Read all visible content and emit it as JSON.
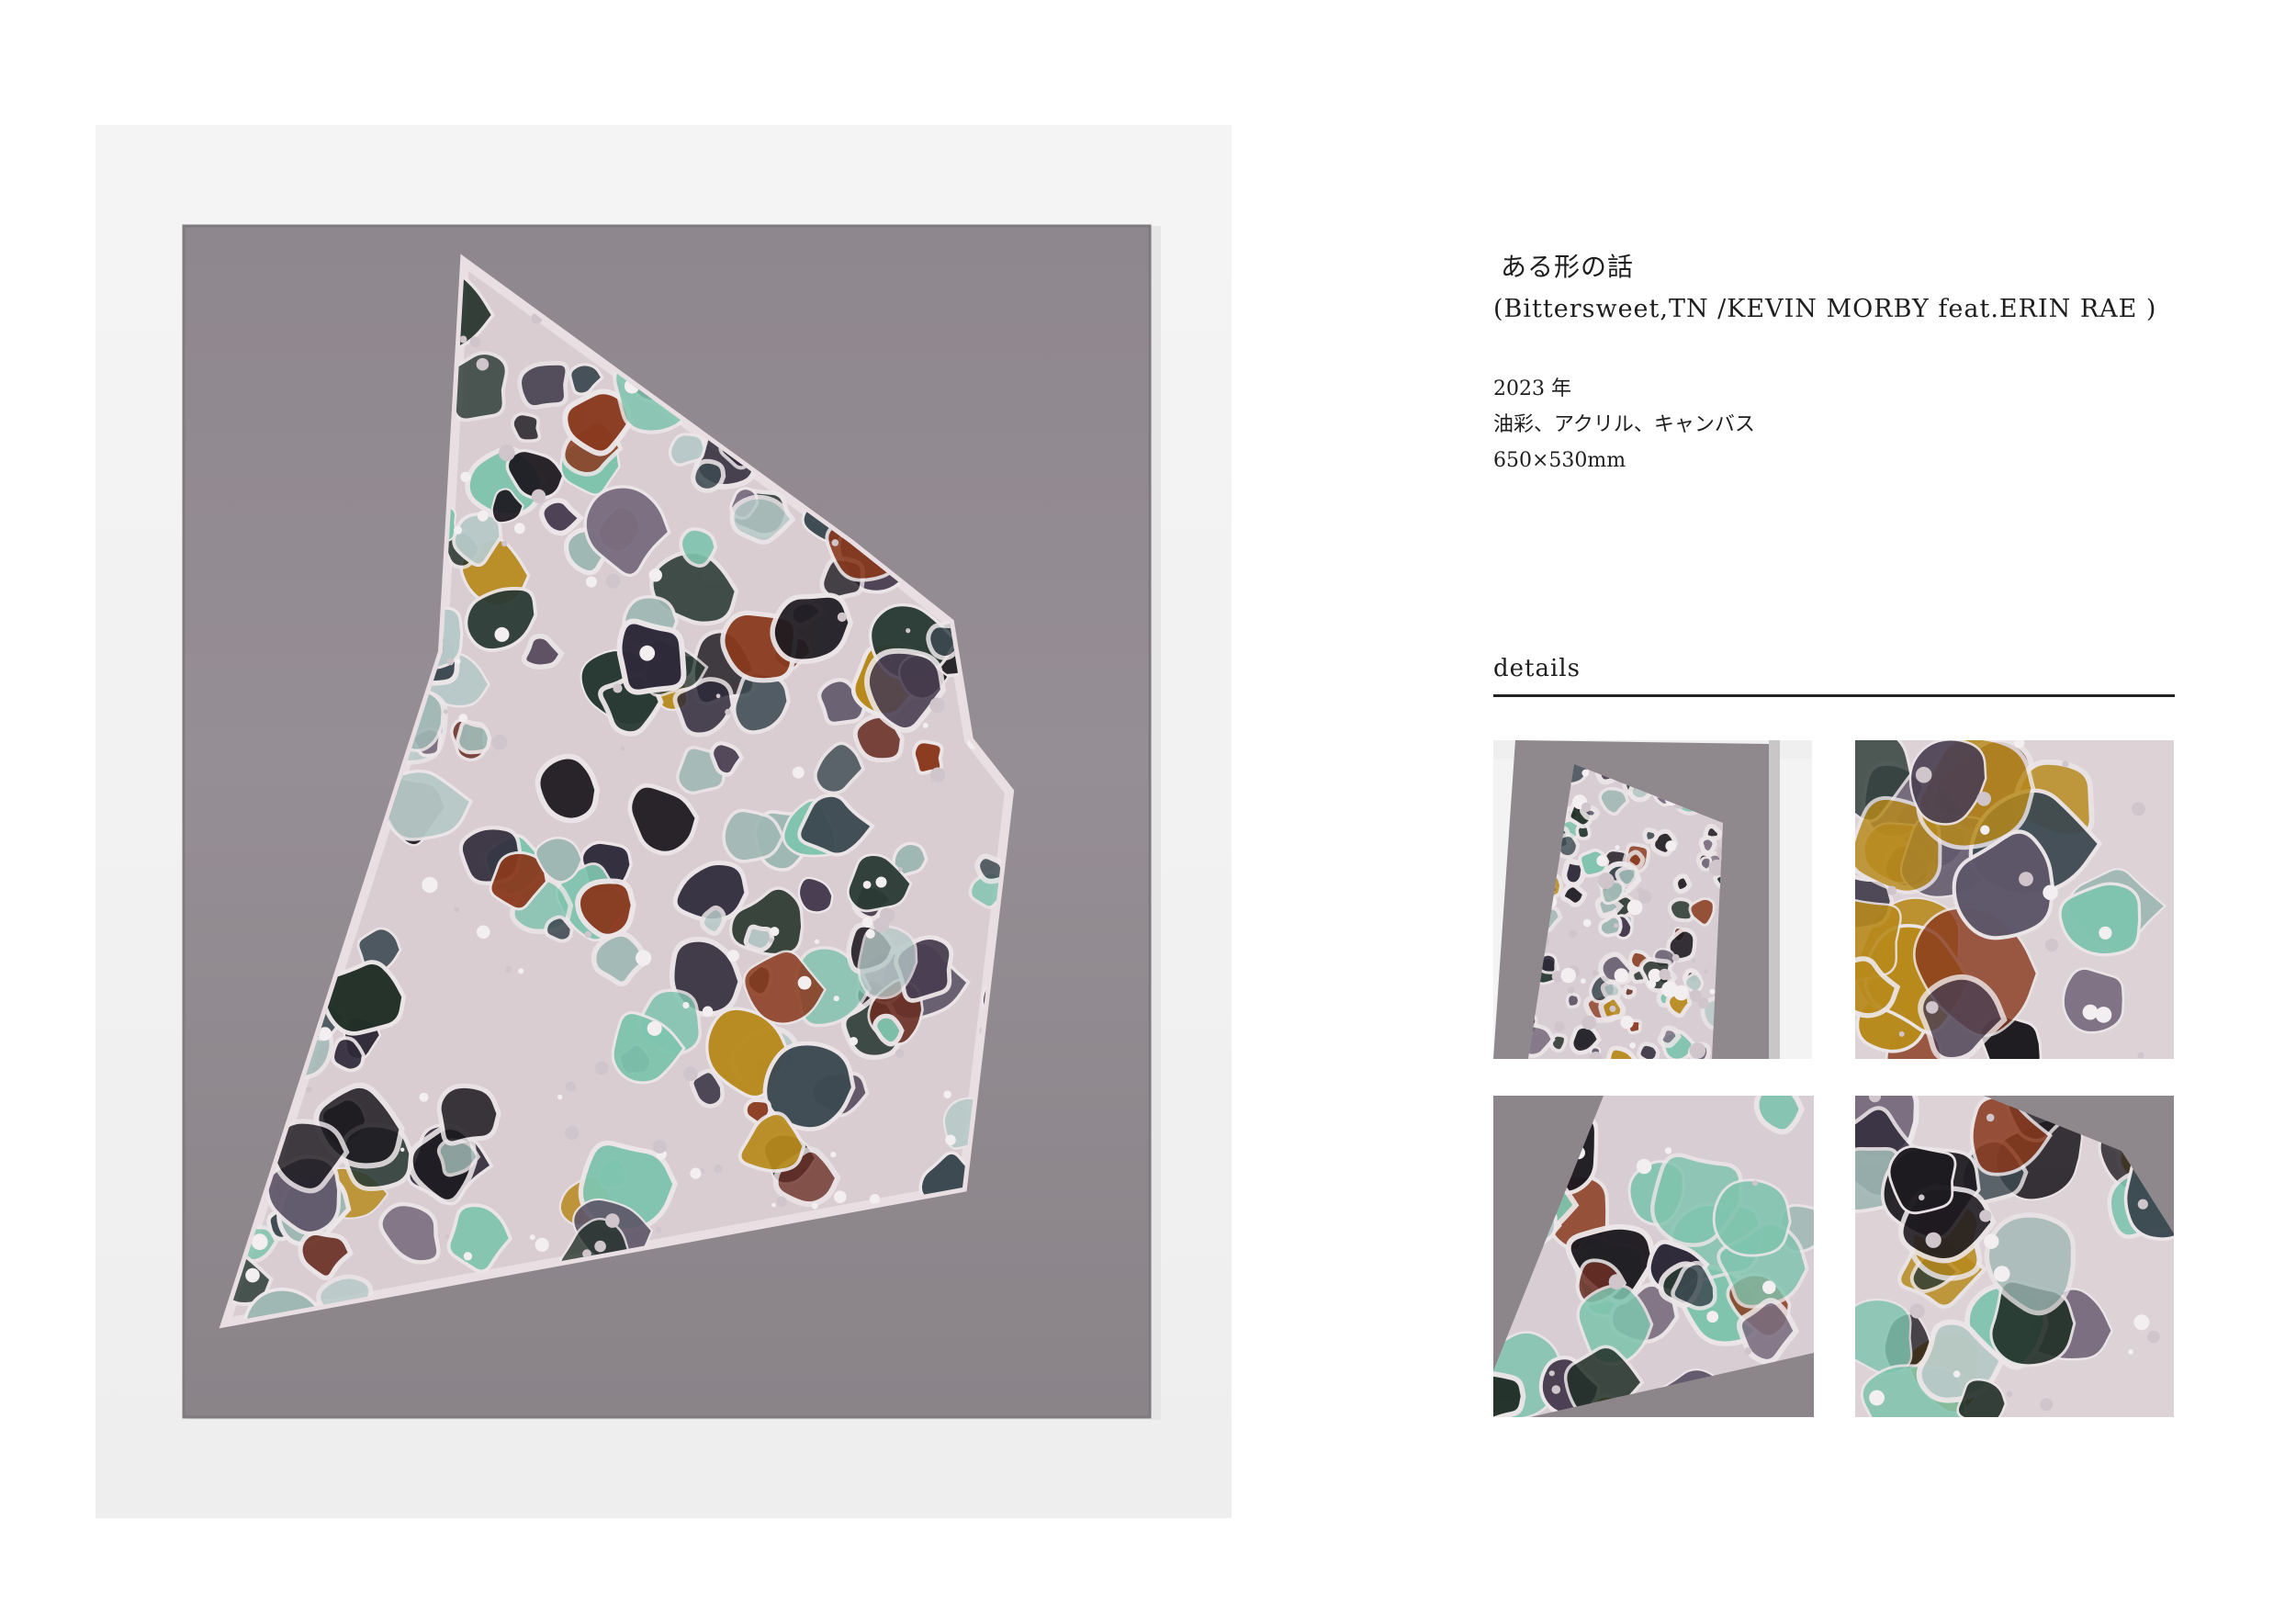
{
  "artwork": {
    "title": "ある形の話",
    "subtitle": "(Bittersweet,TN /KEVIN MORBY feat.ERIN RAE )",
    "year": "2023 年",
    "medium": "油彩、アクリル、キャンバス",
    "size": "650×530mm"
  },
  "details": {
    "heading": "details"
  },
  "colors": {
    "canvas_gray": "#8f8a8e",
    "ochre": "#b88a1c",
    "rust": "#8a3a1e",
    "mint": "#7fc4ae",
    "dark_green": "#2a3a34",
    "near_black": "#1d1a20",
    "chalk_white": "#ece6e8"
  }
}
